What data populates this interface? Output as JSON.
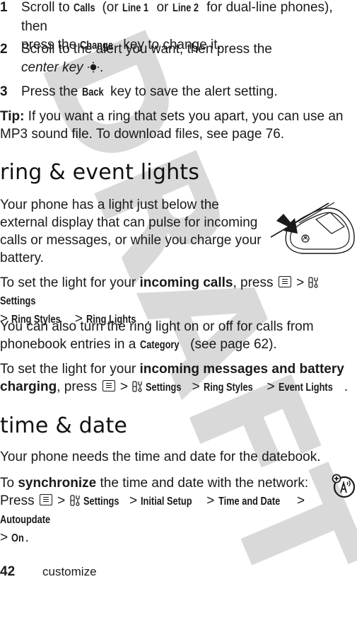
{
  "watermark": "DRAFT",
  "steps": [
    {
      "num": "1",
      "parts": {
        "a": "Scroll to ",
        "calls": "Calls",
        "b": " (or ",
        "line1": "Line 1",
        "c": " or ",
        "line2": "Line 2",
        "d": " for dual-line phones), then",
        "e": "press the ",
        "change": "Change",
        "f": " key to change it."
      }
    },
    {
      "num": "2",
      "parts": {
        "a": "Scroll to the alert you want, then press the",
        "center_key": "center key",
        "b": "."
      }
    },
    {
      "num": "3",
      "parts": {
        "a": "Press the ",
        "back": "Back",
        "b": " key to save the alert setting."
      }
    }
  ],
  "tip": {
    "label": "Tip:",
    "line1": " If you want a ring that sets you apart, you can use an",
    "line2": "MP3 sound file. To download files, see page 76."
  },
  "section_ring_lights": {
    "heading": "ring & event lights",
    "intro": [
      "Your phone has a light just below the",
      "external display that can pulse for incoming",
      "calls or messages, or while you charge your",
      "battery."
    ],
    "incoming_calls": {
      "a": "To set the light for your ",
      "bold": "incoming calls",
      "b": ", press ",
      "gt": ">",
      "settings": "Settings",
      "ring_styles": "Ring Styles",
      "ring_lights": "Ring Lights",
      "end": "."
    },
    "category": {
      "line1": "You can also turn the ring light on or off for calls from",
      "a": "phonebook entries in a ",
      "category": "Category",
      "b": " (see page 62)."
    },
    "messages": {
      "a": "To set the light for your ",
      "bold1": "incoming messages and battery",
      "bold2": "charging",
      "b": ", press ",
      "gt": ">",
      "settings": "Settings",
      "ring_styles": "Ring Styles",
      "event_lights": "Event Lights",
      "end": "."
    }
  },
  "section_time_date": {
    "heading": "time & date",
    "intro": "Your phone needs the time and date for the datebook.",
    "sync": {
      "a": "To ",
      "bold": "synchronize",
      "b": " the time and date with the network:",
      "press": "Press ",
      "gt": ">",
      "settings": "Settings",
      "initial_setup": "Initial Setup",
      "time_and_date": "Time and Date",
      "autoupdate": "Autoupdate",
      "on": "On",
      "end": "."
    }
  },
  "footer": {
    "page_number": "42",
    "section": "customize"
  }
}
